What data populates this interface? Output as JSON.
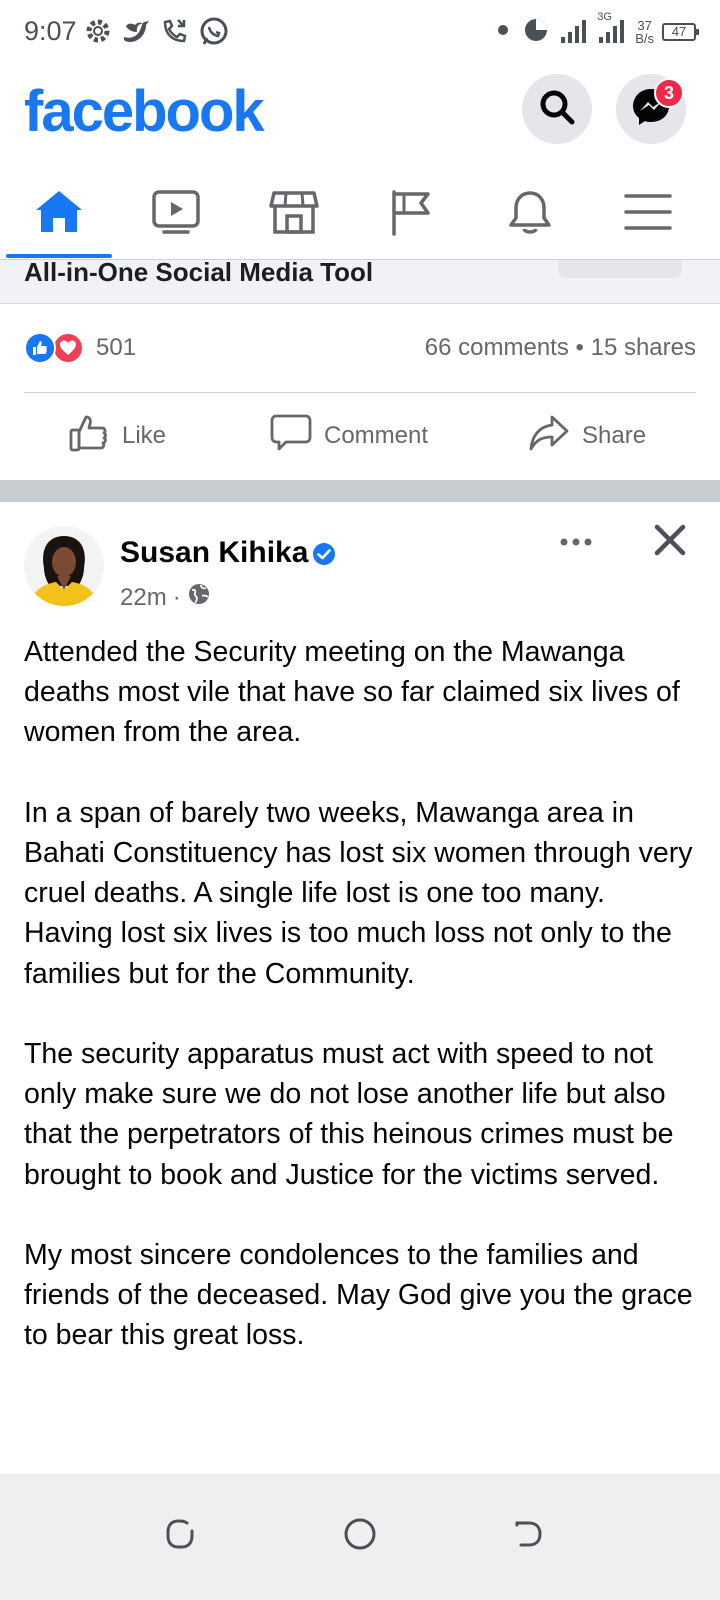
{
  "status_bar": {
    "time": "9:07",
    "network_type": "3G",
    "net_speed_value": "37",
    "net_speed_unit": "B/s",
    "battery": "47",
    "icons": [
      "settings-icon",
      "twitter-icon",
      "missed-call-icon",
      "whatsapp-icon",
      "dot-icon",
      "data-saver-icon",
      "signal-icon",
      "signal-icon"
    ]
  },
  "header": {
    "logo": "facebook",
    "messenger_badge": "3",
    "brand_color": "#1877f2",
    "badge_color": "#f02849"
  },
  "tabs": [
    {
      "name": "home",
      "icon": "home-icon",
      "active": true
    },
    {
      "name": "watch",
      "icon": "video-icon",
      "active": false
    },
    {
      "name": "marketplace",
      "icon": "marketplace-icon",
      "active": false
    },
    {
      "name": "pages",
      "icon": "flag-icon",
      "active": false
    },
    {
      "name": "notifications",
      "icon": "bell-icon",
      "active": false
    },
    {
      "name": "menu",
      "icon": "menu-icon",
      "active": false
    }
  ],
  "previous_post": {
    "link_title": "All-in-One Social Media Tool",
    "reaction_count": "501",
    "comments": "66 comments",
    "separator": "•",
    "shares": "15 shares",
    "actions": {
      "like": "Like",
      "comment": "Comment",
      "share": "Share"
    }
  },
  "post": {
    "author": "Susan Kihika",
    "verified": true,
    "time": "22m",
    "meta_separator": "·",
    "audience": "public",
    "paragraphs": [
      "Attended the Security meeting on the Mawanga deaths most vile that have so far claimed six lives of women from the area.",
      "In a span of barely two weeks, Mawanga area in Bahati Constituency has lost six women through very cruel deaths. A single life lost is one too many. Having lost six lives is too much loss not only to the families but for the Community.",
      "The security apparatus must act with speed to not only make sure we do not lose another life but also that the perpetrators of this heinous crimes must be brought to book and Justice for the victims served.",
      "My most sincere condolences to the families and friends of the deceased. May God give you the grace to bear this great loss."
    ]
  },
  "nav_bar": {
    "buttons": [
      "recents-icon",
      "home-circle-icon",
      "back-icon"
    ]
  }
}
